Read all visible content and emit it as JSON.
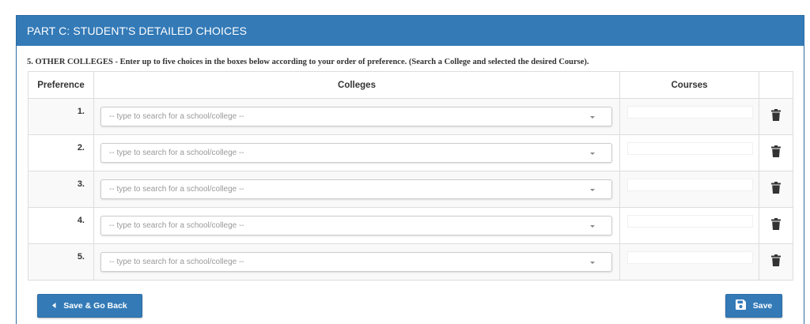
{
  "panel": {
    "title": "PART C: STUDENT'S DETAILED CHOICES"
  },
  "instruction": "5. OTHER COLLEGES - Enter up to five choices in the boxes below according to your order of preference. (Search a College and selected the desired Course).",
  "table": {
    "headers": {
      "preference": "Preference",
      "colleges": "Colleges",
      "courses": "Courses"
    },
    "rows": [
      {
        "pref": "1.",
        "college_placeholder": "-- type to search for a school/college --",
        "course_value": ""
      },
      {
        "pref": "2.",
        "college_placeholder": "-- type to search for a school/college --",
        "course_value": ""
      },
      {
        "pref": "3.",
        "college_placeholder": "-- type to search for a school/college --",
        "course_value": ""
      },
      {
        "pref": "4.",
        "college_placeholder": "-- type to search for a school/college --",
        "course_value": ""
      },
      {
        "pref": "5.",
        "college_placeholder": "-- type to search for a school/college --",
        "course_value": ""
      }
    ]
  },
  "buttons": {
    "back": {
      "label": "Save & Go Back",
      "icon": "chevron-left-icon"
    },
    "save": {
      "label": "Save",
      "icon": "floppy-disk-icon"
    }
  },
  "colors": {
    "primary": "#337ab7",
    "primary_border": "#2e6da4",
    "stripe": "#f9f9f9"
  }
}
